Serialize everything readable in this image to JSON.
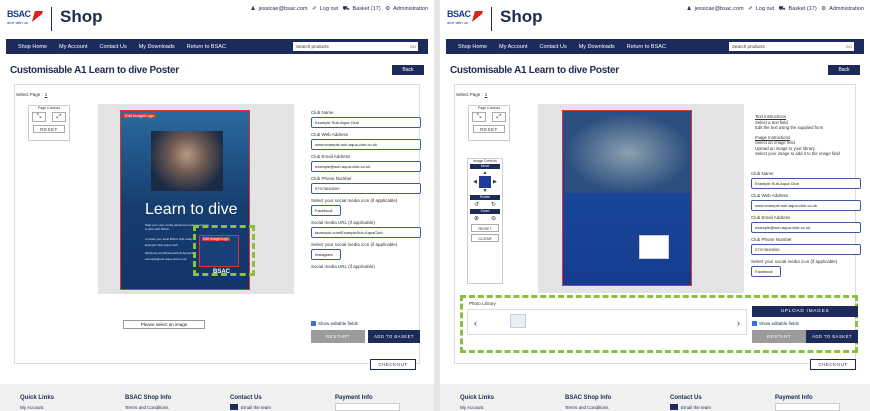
{
  "header": {
    "logo_text": "BSAC",
    "logo_sub": "dive with us",
    "shop": "Shop",
    "user": "jessicae@bsac.com",
    "logout": "Log out",
    "basket": "Basket (17)",
    "admin": "Administration"
  },
  "nav": {
    "items": [
      "Shop Home",
      "My Account",
      "Contact Us",
      "My Downloads",
      "Return to BSAC"
    ],
    "search_placeholder": "Search products",
    "go": "GO"
  },
  "page": {
    "title": "Customisable A1 Learn to dive Poster",
    "back": "Back",
    "select_page": "Select Page :",
    "page_num": "1"
  },
  "page_controls": {
    "title": "Page Controls",
    "reset": "RESET"
  },
  "image_controls": {
    "title": "Image Controls",
    "move": "Move",
    "rotate": "Rotate",
    "zoom": "Zoom",
    "reset": "RESET",
    "clear": "CLEAR"
  },
  "poster": {
    "edit_logo": "Edit Image/Logo",
    "headline": "Learn to dive",
    "sub1": "Start your own scuba adventure today and learn",
    "sub2": "to dive with BSAC.",
    "club": "Contact your local BSAC club today",
    "logo_label": "Edit Image/Logo",
    "brand": "BSAC"
  },
  "form": {
    "club_name_label": "Club Name",
    "club_name": "Example Sub-Aqua Club",
    "web_label": "Club Web Address",
    "web": "www.example-sub-aqua-club.co.uk",
    "email_label": "Club Email Address",
    "email": "example@sub-aqua-club.co.uk",
    "phone_label": "Club Phone Number",
    "phone": "07973640000",
    "social_label": "Select your social media icon (if applicable)",
    "social1": "Facebook",
    "social_url_label": "Social media URL (if applicable)",
    "social_url": "facebook.com/ExampleSub-AquaClub",
    "social2": "Instagram",
    "social2_label": "Select your social media icon (if applicable)",
    "social2_url_label": "Social media URL (if applicable)"
  },
  "instructions": {
    "text_title": "Text Instructions",
    "t1": "Select a text field",
    "t2": "Edit the text using the supplied form",
    "image_title": "Image Instructions",
    "i1": "Select an image field",
    "i2": "Upload an image to your library",
    "i3": "Select your image to add it to the image field"
  },
  "actions": {
    "select_image": "Please select an image",
    "show_editable": "Show editable fields",
    "restart": "RESTART",
    "add_basket": "ADD TO BASKET",
    "checkout": "CHECKOUT",
    "photo_library": "Photo Library",
    "upload": "UPLOAD IMAGES"
  },
  "footer": {
    "quick_links": "Quick Links",
    "quick_sub": "My Account",
    "shop_info": "BSAC Shop Info",
    "shop_sub": "Terms and Conditions",
    "contact": "Contact Us",
    "contact_sub": "Email the team",
    "payment": "Payment Info"
  },
  "colors": {
    "navy": "#1d2b5b",
    "highlight": "#8ac13f",
    "edit_red": "#dd3333"
  }
}
